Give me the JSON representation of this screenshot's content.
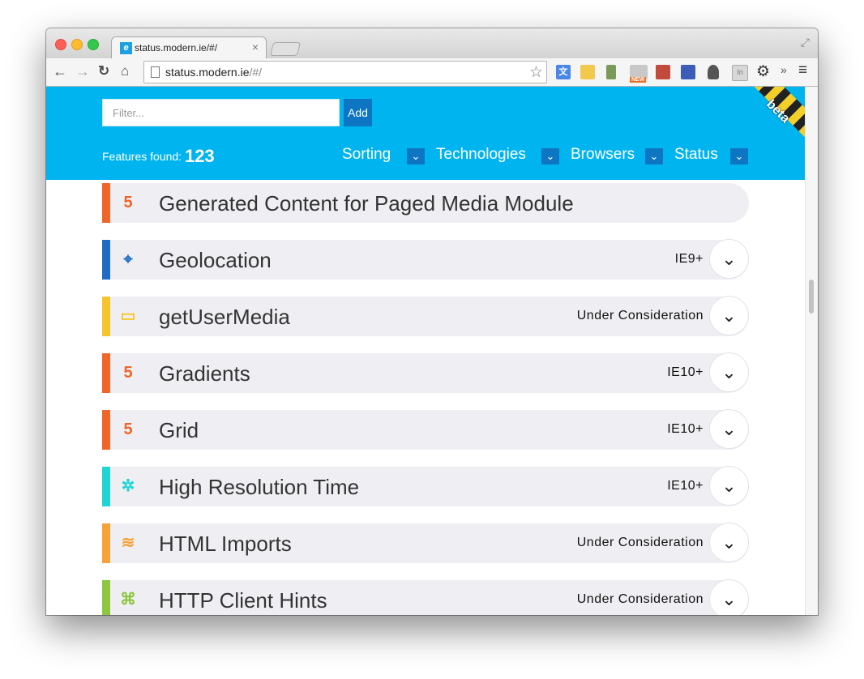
{
  "browser": {
    "tab_title": "status.modern.ie/#/",
    "tab_favicon": "e",
    "url_host": "status.modern.ie",
    "url_rest": "/#/",
    "icons": {
      "back": "←",
      "forward": "→",
      "reload": "↻",
      "home": "⌂",
      "star": "☆",
      "gear": "⚙",
      "more": "»",
      "menu": "≡",
      "close": "×",
      "fullscreen": "⤢",
      "translate": "文",
      "ext_new": "NEW",
      "ext_in": "In"
    }
  },
  "header": {
    "filter_placeholder": "Filter...",
    "add_label": "Add",
    "features_found_label": "Features found:",
    "features_found_count": "123",
    "dropdowns": [
      {
        "label": "Sorting"
      },
      {
        "label": "Technologies"
      },
      {
        "label": "Browsers"
      },
      {
        "label": "Status"
      }
    ],
    "dropdown_arrow": "⌄",
    "beta_label": "beta"
  },
  "features": [
    {
      "name": "Generated Content for Paged Media Module",
      "status": "",
      "icon": "html5-icon",
      "glyph": "5",
      "color": "#f06529"
    },
    {
      "name": "Geolocation",
      "status": "IE9+",
      "icon": "device-icon",
      "glyph": "⌖",
      "color": "#1e6cc4"
    },
    {
      "name": "getUserMedia",
      "status": "Under Consideration",
      "icon": "media-icon",
      "glyph": "▭",
      "color": "#f6c42b"
    },
    {
      "name": "Gradients",
      "status": "IE10+",
      "icon": "html5-icon",
      "glyph": "5",
      "color": "#f06529"
    },
    {
      "name": "Grid",
      "status": "IE10+",
      "icon": "html5-icon",
      "glyph": "5",
      "color": "#f06529"
    },
    {
      "name": "High Resolution Time",
      "status": "IE10+",
      "icon": "gear-like-icon",
      "glyph": "✲",
      "color": "#1fd5d5"
    },
    {
      "name": "HTML Imports",
      "status": "Under Consideration",
      "icon": "layers-icon",
      "glyph": "≋",
      "color": "#f7a238"
    },
    {
      "name": "HTTP Client Hints",
      "status": "Under Consideration",
      "icon": "network-icon",
      "glyph": "⌘",
      "color": "#8dc63f"
    }
  ],
  "expand_glyph": "⌄"
}
